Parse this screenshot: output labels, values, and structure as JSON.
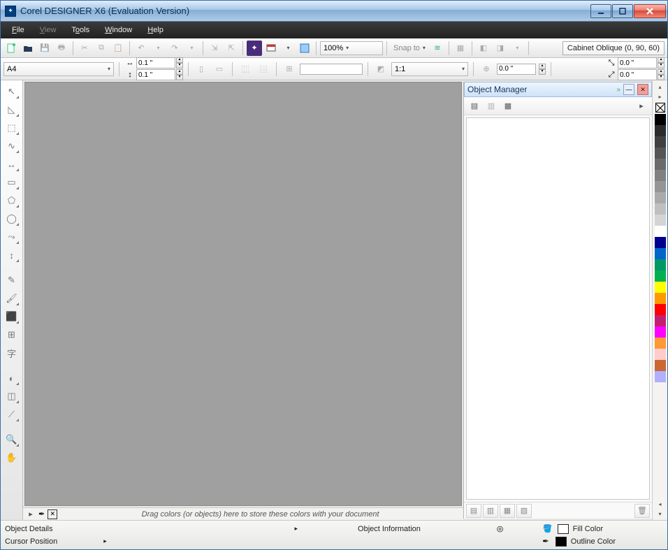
{
  "window": {
    "title": "Corel DESIGNER X6 (Evaluation Version)"
  },
  "menu": {
    "file": "File",
    "view": "View",
    "tools": "Tools",
    "window": "Window",
    "help": "Help"
  },
  "toolbar": {
    "zoom": "100%",
    "snapto": "Snap to",
    "projection": "Cabinet Oblique (0, 90, 60)"
  },
  "propbar": {
    "paper": "A4",
    "nudge_x": "0.1 \"",
    "nudge_y": "0.1 \"",
    "ratio": "1:1",
    "dup_x": "0.0 \"",
    "dup_y": "",
    "off_x": "0.0 \"",
    "off_y": "0.0 \""
  },
  "docker": {
    "title": "Object Manager"
  },
  "colortray": {
    "hint": "Drag colors (or objects) here to store these colors with your document"
  },
  "palette_colors": [
    "#000000",
    "#2b2b2b",
    "#404040",
    "#555555",
    "#6b6b6b",
    "#808080",
    "#959595",
    "#aaaaaa",
    "#bfbfbf",
    "#d4d4d4",
    "#ffffff",
    "#00008f",
    "#0066cc",
    "#009966",
    "#00b050",
    "#ffff00",
    "#ff9900",
    "#ff0000",
    "#c41e72",
    "#ff00ff",
    "#ff9933",
    "#ffcccc",
    "#cc6633",
    "#b0b0ff"
  ],
  "status": {
    "object_details": "Object Details",
    "object_info": "Object Information",
    "cursor_pos": "Cursor Position",
    "fill_label": "Fill Color",
    "outline_label": "Outline Color"
  }
}
